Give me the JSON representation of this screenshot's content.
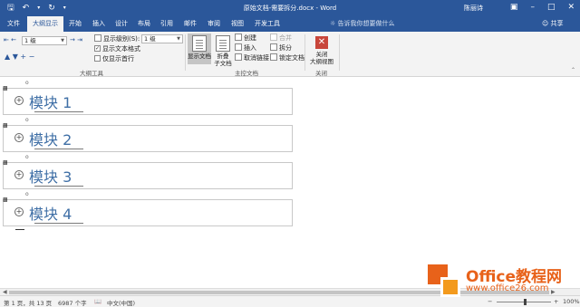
{
  "titlebar": {
    "doc_title": "原始文档-需要拆分.docx - Word",
    "user": "陈丽诗",
    "qat": {
      "save_icon": "save-icon",
      "undo_icon": "undo-icon",
      "redo_icon": "redo-icon",
      "customize_icon": "customize-qat-icon"
    },
    "window_buttons": [
      "ribbon-display-icon",
      "minimize-icon",
      "maximize-icon",
      "close-icon"
    ]
  },
  "tabs": [
    "文件",
    "大纲显示",
    "开始",
    "插入",
    "设计",
    "布局",
    "引用",
    "邮件",
    "审阅",
    "视图",
    "开发工具"
  ],
  "active_tab": "大纲显示",
  "tell_me": "告诉我你想要做什么",
  "share": "共享",
  "ribbon": {
    "outline_tools": {
      "level_value": "1 级",
      "show_level_label": "显示级别(S):",
      "show_level_value": "1 级",
      "show_text_format": "显示文本格式",
      "show_text_format_checked": true,
      "first_line_only": "仅显示首行",
      "first_line_only_checked": false,
      "group_label": "大纲工具"
    },
    "master_document": {
      "show_document": "显示文档",
      "collapse_line1": "折叠",
      "collapse_line2": "子文档",
      "create": "创建",
      "insert": "插入",
      "unlink": "取消链接",
      "merge": "合并",
      "split": "拆分",
      "lock_document": "锁定文档",
      "group_label": "主控文档"
    },
    "close": {
      "close_line1": "关闭",
      "close_line2": "大纲视图",
      "group_label": "关闭"
    }
  },
  "document": {
    "modules": [
      "模块 1",
      "模块 2",
      "模块 3",
      "模块 4"
    ],
    "bullet": "o"
  },
  "statusbar": {
    "page": "第 1 页，共 13 页",
    "words": "6987 个字",
    "language": "中文(中国)",
    "zoom": "100%"
  },
  "watermark": {
    "brand": "Office教程网",
    "url": "www.office26.com",
    "colors": {
      "primary": "#e8621a",
      "secondary": "#f39a1d"
    }
  },
  "colors": {
    "accent": "#2b579a",
    "heading": "#3f6fa6"
  }
}
